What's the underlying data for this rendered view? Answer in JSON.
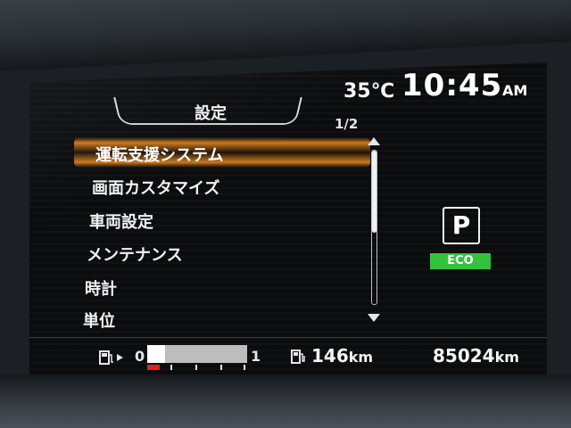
{
  "header": {
    "title": "設定",
    "temperature": "35℃",
    "time": "10:45",
    "ampm": "AM",
    "page_indicator": "1/2"
  },
  "menu": {
    "items": [
      {
        "label": "運転支援システム",
        "selected": true
      },
      {
        "label": "画面カスタマイズ",
        "selected": false
      },
      {
        "label": "車両設定",
        "selected": false
      },
      {
        "label": "メンテナンス",
        "selected": false
      },
      {
        "label": "時計",
        "selected": false
      },
      {
        "label": "単位",
        "selected": false
      }
    ]
  },
  "status": {
    "gear": "P",
    "eco": "ECO"
  },
  "bottom": {
    "fuel_meter_min": "0",
    "fuel_meter_max": "1",
    "fuel_level": 0.18,
    "range_value": "146",
    "range_unit": "km",
    "odometer_value": "85024",
    "odometer_unit": "km"
  },
  "colors": {
    "highlight": "#f08c1e",
    "eco_green": "#32c33a",
    "fuel_low_red": "#e02020"
  },
  "icons": [
    "fuel-pump-icon",
    "fuel-range-icon",
    "scroll-up-arrow-icon",
    "scroll-down-arrow-icon"
  ]
}
